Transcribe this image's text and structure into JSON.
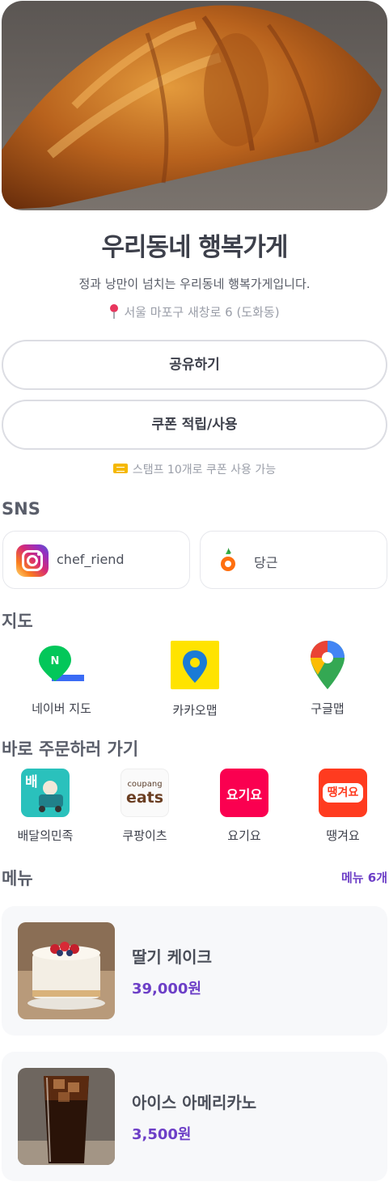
{
  "store": {
    "name": "우리동네 행복가게",
    "description": "정과 낭만이 넘치는 우리동네 행복가게입니다.",
    "address": "서울 마포구 새창로 6 (도화동)"
  },
  "actions": {
    "share_label": "공유하기",
    "coupon_label": "쿠폰 적립/사용",
    "stamp_note": "스탬프 10개로 쿠폰 사용 가능"
  },
  "sns": {
    "title": "SNS",
    "items": [
      {
        "label": "chef_riend",
        "icon": "instagram-icon"
      },
      {
        "label": "당근",
        "icon": "carrot-icon"
      }
    ]
  },
  "maps": {
    "title": "지도",
    "items": [
      {
        "label": "네이버 지도",
        "icon": "naver-map-icon"
      },
      {
        "label": "카카오맵",
        "icon": "kakao-map-icon"
      },
      {
        "label": "구글맵",
        "icon": "google-maps-icon"
      }
    ]
  },
  "order": {
    "title": "바로 주문하러 가기",
    "items": [
      {
        "label": "배달의민족",
        "icon": "baemin-icon",
        "logo_text": "배"
      },
      {
        "label": "쿠팡이츠",
        "icon": "coupang-eats-icon",
        "logo_text_1": "coupang",
        "logo_text_2": "eats"
      },
      {
        "label": "요기요",
        "icon": "yogiyo-icon",
        "logo_text": "요기요"
      },
      {
        "label": "땡겨요",
        "icon": "ddangyo-icon",
        "logo_text": "땡겨요"
      }
    ]
  },
  "menu": {
    "title": "메뉴",
    "count_label": "메뉴 6개",
    "items": [
      {
        "name": "딸기 케이크",
        "price": "39,000원"
      },
      {
        "name": "아이스 아메리카노",
        "price": "3,500원"
      }
    ]
  },
  "colors": {
    "accent": "#6d3fc7",
    "border": "#dcdde3",
    "card_bg": "#f7f8fa"
  }
}
